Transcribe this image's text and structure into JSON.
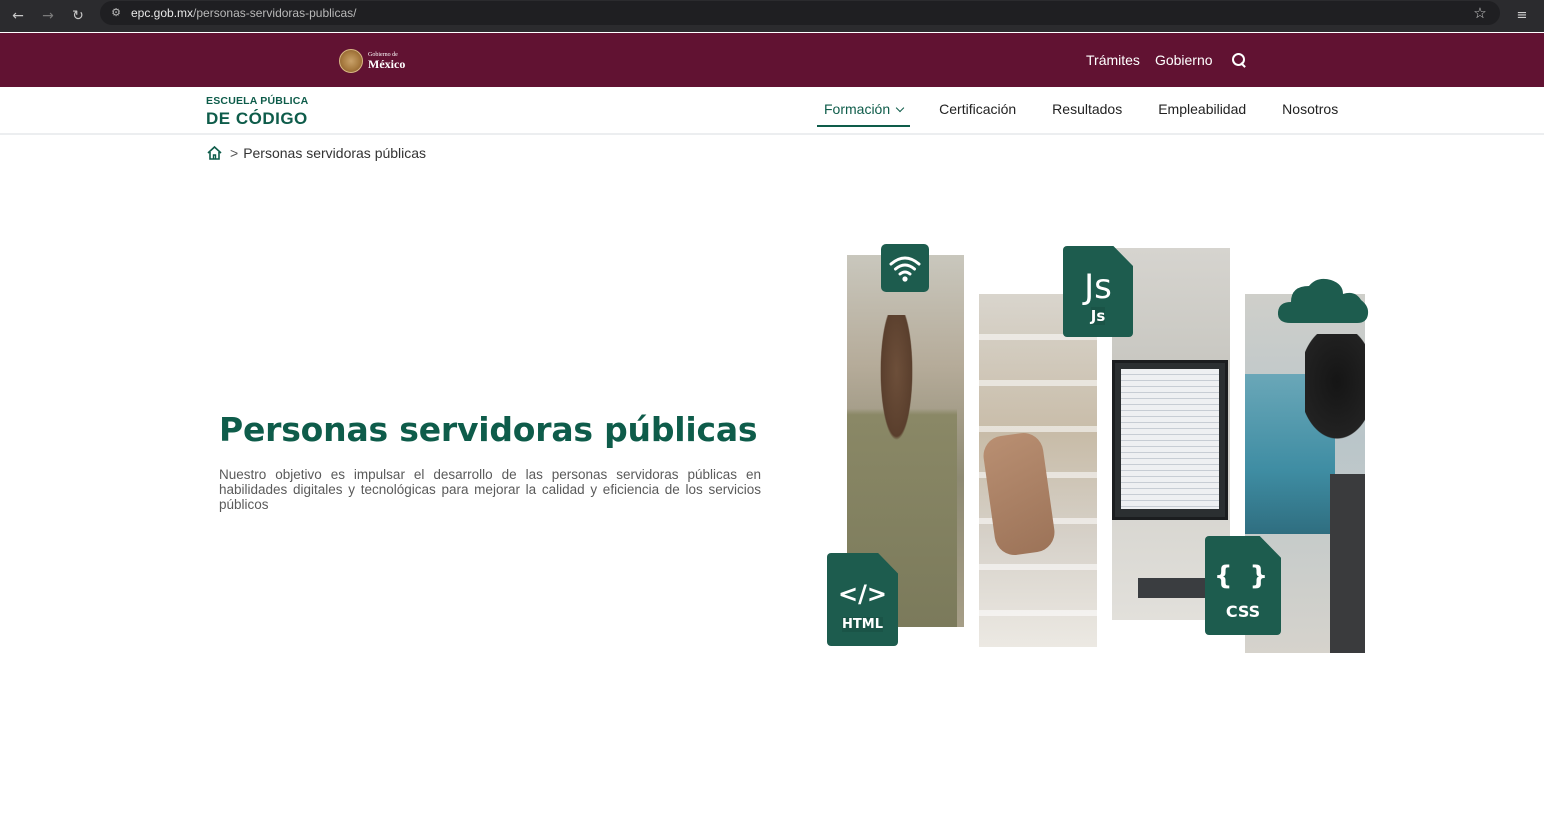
{
  "browser": {
    "url_host": "epc.gob.mx",
    "url_path": "/personas-servidoras-publicas/"
  },
  "gov_header": {
    "logo_small": "Gobierno de",
    "logo_big": "México",
    "links": [
      "Trámites",
      "Gobierno"
    ]
  },
  "site": {
    "logo_line1": "ESCUELA PÚBLICA",
    "logo_line2": "DE CÓDIGO",
    "menu": [
      {
        "label": "Formación",
        "active": true
      },
      {
        "label": "Certificación",
        "active": false
      },
      {
        "label": "Resultados",
        "active": false
      },
      {
        "label": "Empleabilidad",
        "active": false
      },
      {
        "label": "Nosotros",
        "active": false
      }
    ]
  },
  "breadcrumb": {
    "separator": ">",
    "current": "Personas servidoras públicas"
  },
  "hero": {
    "title": "Personas servidoras públicas",
    "description": "Nuestro objetivo es impulsar el desarrollo de las personas servidoras públicas en habilidades digitales y tecnológicas para mejorar la calidad y eficiencia de los servicios públicos"
  },
  "collage": {
    "js_big": "Js",
    "js_small": "Js",
    "html_big": "</>",
    "html_small": "HTML",
    "css_big": "{ }",
    "css_small": "CSS"
  },
  "colors": {
    "gov_bar": "#611232",
    "brand_green": "#0e5c4a",
    "badge_green": "#1d5c4e"
  }
}
